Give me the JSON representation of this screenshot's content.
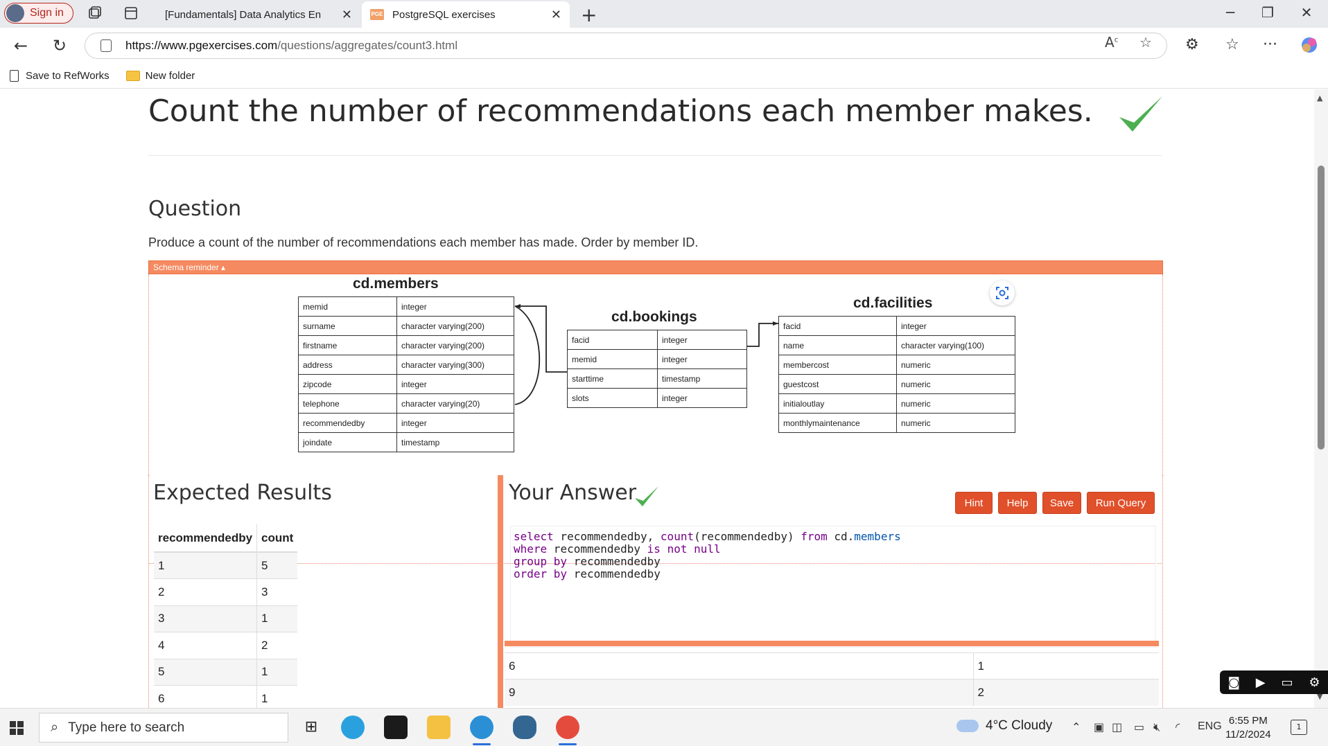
{
  "browser": {
    "profile_label": "Sign in",
    "tabs": [
      {
        "title": "[Fundamentals] Data Analytics En"
      },
      {
        "title": "PostgreSQL exercises"
      }
    ],
    "url_domain": "https://www.pgexercises.com",
    "url_path": "/questions/aggregates/count3.html",
    "bookmarks": [
      {
        "label": "Save to RefWorks"
      },
      {
        "label": "New folder"
      }
    ]
  },
  "page": {
    "title": "Count the number of recommendations each member makes.",
    "question_heading": "Question",
    "question_text": "Produce a count of the number of recommendations each member has made. Order by member ID.",
    "schema_toggle": "Schema reminder ▴",
    "schema": {
      "members": {
        "title": "cd.members",
        "rows": [
          [
            "memid",
            "integer"
          ],
          [
            "surname",
            "character varying(200)"
          ],
          [
            "firstname",
            "character varying(200)"
          ],
          [
            "address",
            "character varying(300)"
          ],
          [
            "zipcode",
            "integer"
          ],
          [
            "telephone",
            "character varying(20)"
          ],
          [
            "recommendedby",
            "integer"
          ],
          [
            "joindate",
            "timestamp"
          ]
        ]
      },
      "bookings": {
        "title": "cd.bookings",
        "rows": [
          [
            "facid",
            "integer"
          ],
          [
            "memid",
            "integer"
          ],
          [
            "starttime",
            "timestamp"
          ],
          [
            "slots",
            "integer"
          ]
        ]
      },
      "facilities": {
        "title": "cd.facilities",
        "rows": [
          [
            "facid",
            "integer"
          ],
          [
            "name",
            "character varying(100)"
          ],
          [
            "membercost",
            "numeric"
          ],
          [
            "guestcost",
            "numeric"
          ],
          [
            "initialoutlay",
            "numeric"
          ],
          [
            "monthlymaintenance",
            "numeric"
          ]
        ]
      }
    },
    "expected": {
      "heading": "Expected Results",
      "headers": [
        "recommendedby",
        "count"
      ],
      "rows": [
        [
          "1",
          "5"
        ],
        [
          "2",
          "3"
        ],
        [
          "3",
          "1"
        ],
        [
          "4",
          "2"
        ],
        [
          "5",
          "1"
        ],
        [
          "6",
          "1"
        ]
      ]
    },
    "answer": {
      "heading": "Your Answer",
      "buttons": [
        "Hint",
        "Help",
        "Save",
        "Run Query"
      ],
      "code_lines": [
        "select recommendedby, count(recommendedby) from cd.members",
        "where recommendedby is not null",
        "group by recommendedby",
        "order by recommendedby"
      ],
      "output_rows": [
        [
          "6",
          "1"
        ],
        [
          "9",
          "2"
        ]
      ]
    }
  },
  "taskbar": {
    "search_placeholder": "Type here to search",
    "weather": "4°C  Cloudy",
    "lang": "ENG",
    "time": "6:55 PM",
    "date": "11/2/2024",
    "notif_count": "1"
  },
  "colors": {
    "accent_orange": "#f58a60",
    "button_red": "#e0502a",
    "check_green": "#4caf50"
  }
}
